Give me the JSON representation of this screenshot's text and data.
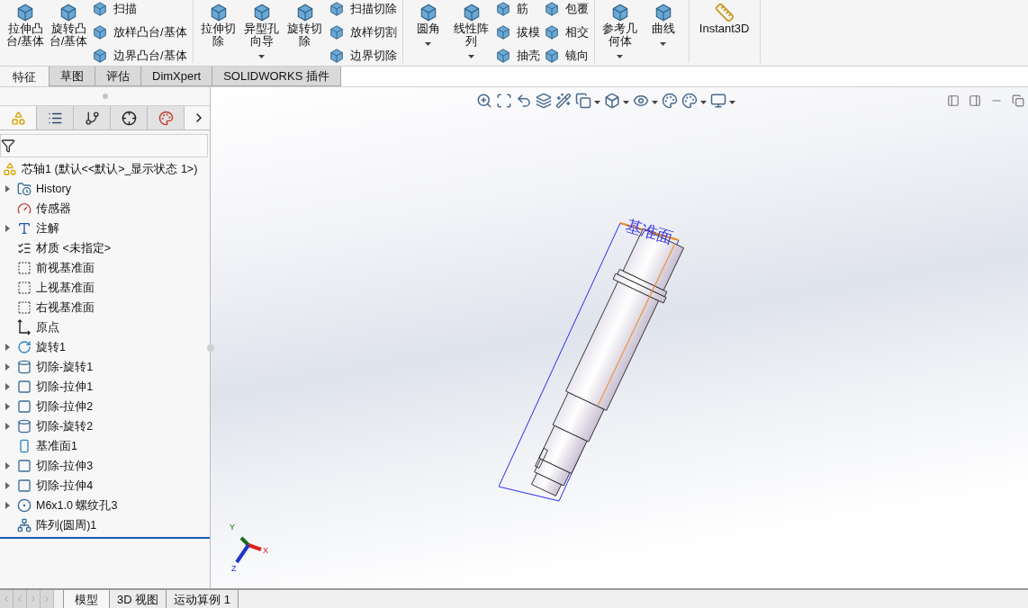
{
  "ribbon": {
    "groups": [
      {
        "large": [
          {
            "label": "拉伸凸台/基体",
            "dropdown": false,
            "kind": "cube"
          },
          {
            "label": "旋转凸台/基体",
            "dropdown": false,
            "kind": "cube"
          }
        ],
        "small_columns": [
          [
            {
              "label": "扫描"
            },
            {
              "label": "放样凸台/基体"
            },
            {
              "label": "边界凸台/基体"
            }
          ]
        ]
      },
      {
        "large": [
          {
            "label": "拉伸切除",
            "dropdown": false,
            "kind": "cube"
          },
          {
            "label": "异型孔向导",
            "dropdown": true,
            "kind": "cube"
          },
          {
            "label": "旋转切除",
            "dropdown": false,
            "kind": "cube"
          }
        ],
        "small_columns": [
          [
            {
              "label": "扫描切除"
            },
            {
              "label": "放样切割"
            },
            {
              "label": "边界切除"
            }
          ]
        ]
      },
      {
        "large": [
          {
            "label": "圆角",
            "dropdown": true,
            "kind": "cube"
          },
          {
            "label": "线性阵列",
            "dropdown": true,
            "kind": "cube"
          }
        ],
        "small_columns": [
          [
            {
              "label": "筋"
            },
            {
              "label": "拔模"
            },
            {
              "label": "抽壳"
            }
          ],
          [
            {
              "label": "包覆"
            },
            {
              "label": "相交"
            },
            {
              "label": "镜向"
            }
          ]
        ]
      },
      {
        "large": [
          {
            "label": "参考几何体",
            "dropdown": true,
            "kind": "cube"
          },
          {
            "label": "曲线",
            "dropdown": true,
            "kind": "cube"
          }
        ]
      },
      {
        "large": [
          {
            "label": "Instant3D",
            "dropdown": false,
            "kind": "ruler"
          }
        ]
      }
    ]
  },
  "tabs": [
    {
      "label": "特征",
      "selected": true
    },
    {
      "label": "草图",
      "selected": false
    },
    {
      "label": "评估",
      "selected": false
    },
    {
      "label": "DimXpert",
      "selected": false
    },
    {
      "label": "SOLIDWORKS 插件",
      "selected": false
    }
  ],
  "panel_tabs": [
    {
      "kind": "part",
      "selected": true
    },
    {
      "kind": "list",
      "selected": false
    },
    {
      "kind": "config",
      "selected": false
    },
    {
      "kind": "target",
      "selected": false
    },
    {
      "kind": "appearance",
      "selected": false
    }
  ],
  "tree": {
    "root": "芯轴1  (默认<<默认>_显示状态 1>)",
    "items": [
      {
        "label": "History",
        "kind": "history",
        "expandable": true
      },
      {
        "label": "传感器",
        "kind": "sensor",
        "expandable": false
      },
      {
        "label": "注解",
        "kind": "annotation",
        "expandable": true
      },
      {
        "label": "材质 <未指定>",
        "kind": "material",
        "expandable": false
      },
      {
        "label": "前视基准面",
        "kind": "plane",
        "expandable": false
      },
      {
        "label": "上视基准面",
        "kind": "plane",
        "expandable": false
      },
      {
        "label": "右视基准面",
        "kind": "plane",
        "expandable": false
      },
      {
        "label": "原点",
        "kind": "origin",
        "expandable": false
      },
      {
        "label": "旋转1",
        "kind": "revolve",
        "expandable": true
      },
      {
        "label": "切除-旋转1",
        "kind": "cut-revolve",
        "expandable": true
      },
      {
        "label": "切除-拉伸1",
        "kind": "cut-extrude",
        "expandable": true
      },
      {
        "label": "切除-拉伸2",
        "kind": "cut-extrude",
        "expandable": true
      },
      {
        "label": "切除-旋转2",
        "kind": "cut-revolve",
        "expandable": true
      },
      {
        "label": "基准面1",
        "kind": "ref-plane",
        "expandable": false
      },
      {
        "label": "切除-拉伸3",
        "kind": "cut-extrude",
        "expandable": true
      },
      {
        "label": "切除-拉伸4",
        "kind": "cut-extrude",
        "expandable": true
      },
      {
        "label": "M6x1.0 螺纹孔3",
        "kind": "hole",
        "expandable": true
      },
      {
        "label": "阵列(圆周)1",
        "kind": "pattern",
        "expandable": false
      }
    ]
  },
  "viewport": {
    "plane_label": "基准面",
    "triad": {
      "x": "X",
      "y": "Y",
      "z": "Z"
    }
  },
  "bottom_tabs": [
    {
      "label": "模型",
      "selected": true
    },
    {
      "label": "3D 视图",
      "selected": false
    },
    {
      "label": "运动算例 1",
      "selected": false
    }
  ]
}
